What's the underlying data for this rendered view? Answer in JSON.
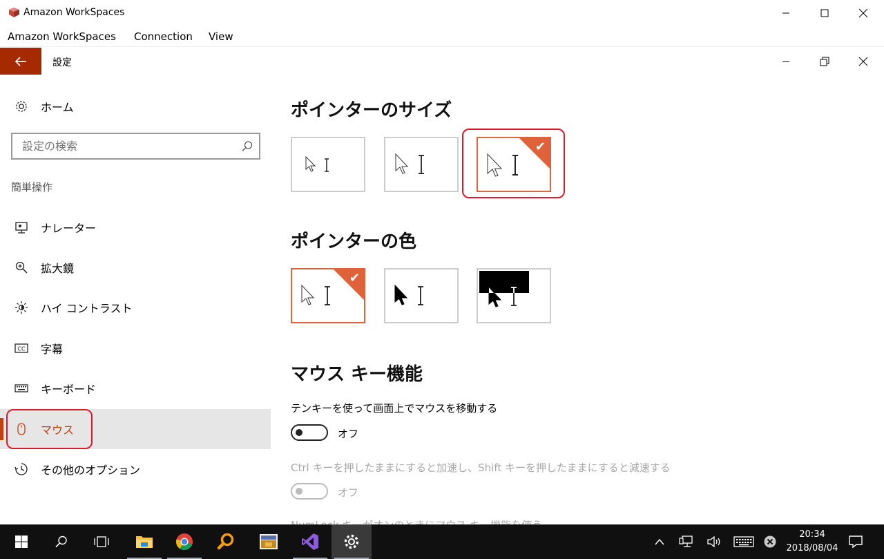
{
  "outer_window": {
    "title": "Amazon WorkSpaces",
    "menu": [
      "Amazon WorkSpaces",
      "Connection",
      "View"
    ]
  },
  "settings": {
    "title": "設定",
    "home_label": "ホーム",
    "search_placeholder": "設定の検索",
    "group_header": "簡単操作",
    "nav_items": [
      {
        "label": "ナレーター",
        "icon": "narrator-icon"
      },
      {
        "label": "拡大鏡",
        "icon": "magnifier-icon"
      },
      {
        "label": "ハイ コントラスト",
        "icon": "high-contrast-icon"
      },
      {
        "label": "字幕",
        "icon": "closed-caption-icon"
      },
      {
        "label": "キーボード",
        "icon": "keyboard-icon"
      },
      {
        "label": "マウス",
        "icon": "mouse-icon",
        "selected": true
      },
      {
        "label": "その他のオプション",
        "icon": "other-options-icon"
      }
    ]
  },
  "content": {
    "pointer_size_title": "ポインターのサイズ",
    "pointer_size_selected": 3,
    "pointer_color_title": "ポインターの色",
    "pointer_color_selected": 1,
    "mouse_keys_title": "マウス キー機能",
    "mouse_keys_label": "テンキーを使って画面上でマウスを移動する",
    "mouse_keys_state": "オフ",
    "ctrl_shift_label": "Ctrl キーを押したままにすると加速し、Shift キーを押したままにすると減速する",
    "ctrl_shift_state": "オフ",
    "numlock_label": "NumLock キーがオンのときにマウス キー機能を使う"
  },
  "taskbar": {
    "apps": [
      "start-icon",
      "search-icon",
      "task-view-icon",
      "file-explorer-icon",
      "chrome-icon",
      "search-app-icon",
      "screen-app-icon",
      "visual-studio-icon",
      "settings-icon"
    ],
    "clock_time": "20:34",
    "clock_date": "2018/08/04"
  },
  "colors": {
    "accent": "#c2410c",
    "selected_tile": "#e0623a",
    "back_button": "#a52a00",
    "highlight": "#e0182b"
  }
}
